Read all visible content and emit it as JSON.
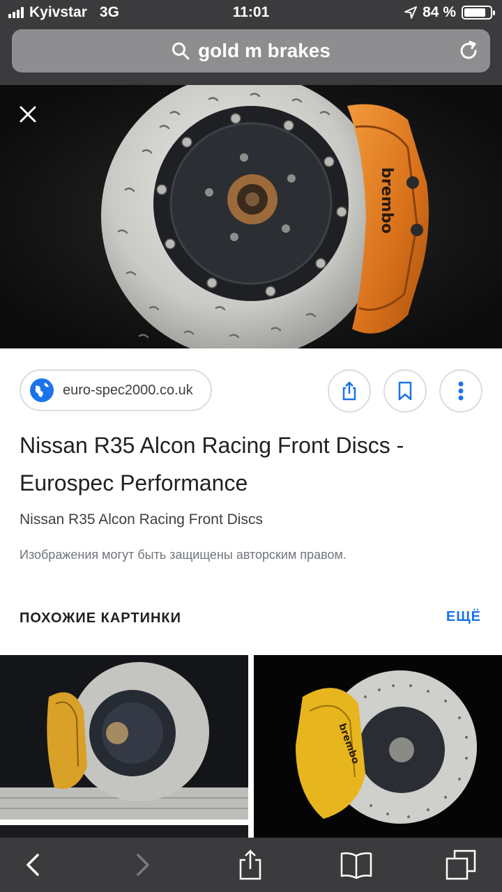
{
  "status_bar": {
    "carrier": "Kyivstar",
    "network": "3G",
    "time": "11:01",
    "battery_percent": "84 %",
    "battery_level": 0.84
  },
  "search": {
    "query": "gold m brakes",
    "search_icon": "search-icon",
    "reload_icon": "reload-icon"
  },
  "image_viewer": {
    "close_icon": "close-icon",
    "caliper_brand": "brembo"
  },
  "result": {
    "domain": "euro-spec2000.co.uk",
    "title_line1": "Nissan R35 Alcon Racing Front Discs -",
    "title_line2": "Eurospec Performance",
    "subtitle": "Nissan R35 Alcon Racing Front Discs",
    "copyright_notice": "Изображения могут быть защищены авторским правом.",
    "actions": [
      "share-icon",
      "bookmark-icon",
      "more-vert-icon"
    ]
  },
  "related": {
    "heading": "ПОХОЖИЕ КАРТИНКИ",
    "more_label": "ЕЩЁ",
    "thumbnails": [
      {
        "icon": "brake-photo",
        "caliper_color": "#d9a128"
      },
      {
        "icon": "brake-photo",
        "caliper_color": "#e7b51e",
        "caliper_brand": "brembo"
      }
    ]
  },
  "toolbar": {
    "items": [
      "back-icon",
      "forward-icon",
      "share-icon",
      "bookmarks-icon",
      "tabs-icon"
    ]
  },
  "colors": {
    "chrome": "#3b3b3d",
    "url_bar": "#8e8e91",
    "link_blue": "#1a73e8",
    "caliper_orange": "#e0761a"
  }
}
